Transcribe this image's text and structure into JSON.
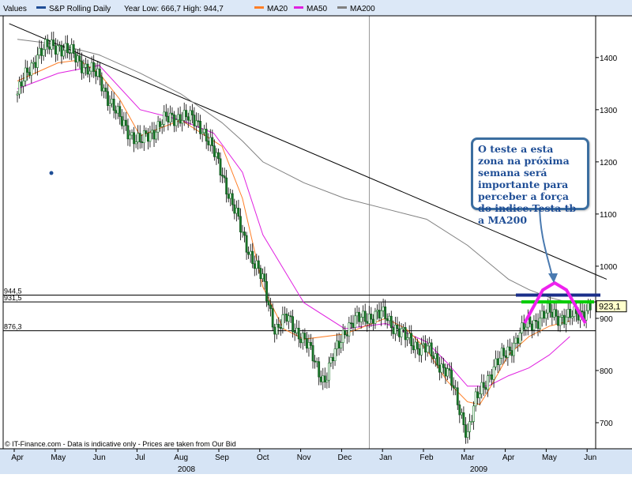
{
  "chart_data": {
    "type": "candlestick",
    "legend": {
      "values_label": "Values",
      "items": [
        {
          "name": "S&P Rolling Daily",
          "color": "#1f4e96"
        },
        {
          "name": "Year Low: 666,7  High: 944,7",
          "color": ""
        },
        {
          "name": "MA20",
          "color": "#ff7f27"
        },
        {
          "name": "MA50",
          "color": "#e020e0"
        },
        {
          "name": "MA200",
          "color": "#808080"
        }
      ]
    },
    "y_axis": {
      "min": 650,
      "max": 1480,
      "ticks": [
        700,
        800,
        900,
        1000,
        1100,
        1200,
        1300,
        1400
      ],
      "position": "right"
    },
    "x_axis": {
      "months": [
        "Apr",
        "May",
        "Jun",
        "Jul",
        "Aug",
        "Sep",
        "Oct",
        "Nov",
        "Dec",
        "Jan",
        "Feb",
        "Mar",
        "Apr",
        "May",
        "Jun"
      ],
      "years": [
        "2008",
        "2009"
      ]
    },
    "price_series": {
      "name": "S&P Rolling Daily",
      "t": [
        0,
        0.5,
        1,
        1.5,
        2,
        2.5,
        3,
        3.5,
        4,
        4.5,
        5,
        5.5,
        6,
        6.3,
        6.6,
        7,
        7.5,
        8,
        8.5,
        9,
        9.5,
        10,
        10.5,
        11,
        11.2,
        11.5,
        12,
        12.5,
        13,
        13.5,
        14
      ],
      "close": [
        1330,
        1410,
        1425,
        1395,
        1360,
        1280,
        1235,
        1275,
        1290,
        1270,
        1180,
        1060,
        970,
        880,
        900,
        860,
        780,
        880,
        905,
        905,
        860,
        840,
        800,
        680,
        740,
        790,
        840,
        890,
        910,
        900,
        923.1
      ]
    },
    "ma20": {
      "t": [
        0,
        1,
        1.5,
        2,
        2.5,
        3,
        4,
        5,
        5.5,
        6,
        6.5,
        7,
        8,
        9,
        9.5,
        10,
        10.5,
        11,
        11.3,
        11.5,
        12,
        12.5,
        13,
        13.5
      ],
      "v": [
        1355,
        1390,
        1395,
        1370,
        1320,
        1250,
        1280,
        1230,
        1130,
        960,
        880,
        860,
        870,
        900,
        880,
        840,
        780,
        740,
        735,
        760,
        830,
        865,
        885,
        895
      ]
    },
    "ma50": {
      "t": [
        0,
        1,
        2,
        3,
        4,
        4.8,
        5.5,
        6,
        7,
        8,
        9,
        10,
        10.5,
        11,
        11.5,
        12,
        12.5,
        13,
        13.5
      ],
      "v": [
        1340,
        1370,
        1385,
        1300,
        1280,
        1255,
        1180,
        1060,
        930,
        880,
        890,
        855,
        815,
        770,
        770,
        790,
        805,
        830,
        865
      ]
    },
    "ma200": {
      "t": [
        0,
        1,
        2,
        3,
        4,
        5,
        5.5,
        6,
        7,
        8,
        9,
        10,
        11,
        12,
        12.5,
        13,
        13.5
      ],
      "v": [
        1435,
        1425,
        1405,
        1370,
        1330,
        1275,
        1240,
        1200,
        1160,
        1130,
        1110,
        1090,
        1040,
        975,
        955,
        940,
        930
      ]
    },
    "trendline": {
      "t": [
        -0.2,
        14.4
      ],
      "v": [
        1465,
        975
      ]
    },
    "h_levels": [
      {
        "label": "944,5",
        "value": 944.5
      },
      {
        "label": "931,5",
        "value": 931.5
      },
      {
        "label": "876,3",
        "value": 876.3
      }
    ],
    "last_price_label": "923,1",
    "last_price_value": 923.1,
    "footer": "© IT-Finance.com - Data is indicative only - Prices are taken from Our Bid",
    "annotation_text": "O teste a esta zona na próxima semana será importante para perceber a força do indice.Testa tb a MA200"
  }
}
